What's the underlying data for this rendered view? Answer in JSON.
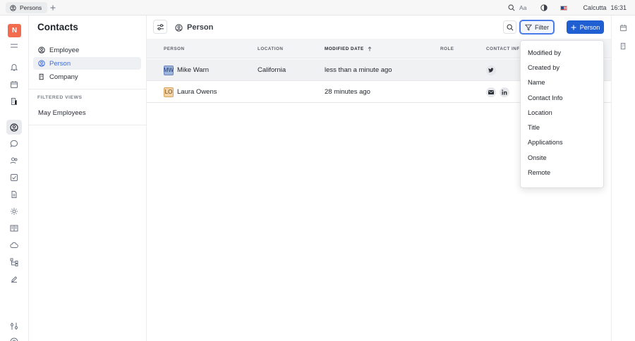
{
  "tabs": [
    {
      "label": "Persons",
      "icon": "person-circle-icon"
    }
  ],
  "topbar": {
    "font_label": "Aa",
    "location": "Calcutta",
    "time": "16:31"
  },
  "workspace": {
    "logo_letter": "N",
    "logo_color": "#f26c4f"
  },
  "contacts_panel": {
    "title": "Contacts",
    "items": [
      {
        "label": "Employee",
        "icon": "person-circle-icon",
        "active": false
      },
      {
        "label": "Person",
        "icon": "person-circle-icon",
        "active": true
      },
      {
        "label": "Company",
        "icon": "building-icon",
        "active": false
      }
    ],
    "filtered_views_label": "FILTERED VIEWS",
    "views": [
      {
        "label": "May Employees"
      }
    ]
  },
  "main": {
    "title": "Person",
    "filter_label": "Filter",
    "add_label": "Person",
    "accent_color": "#1f5fd1"
  },
  "table": {
    "columns": [
      "PERSON",
      "LOCATION",
      "MODIFIED DATE",
      "ROLE",
      "CONTACT INFO"
    ],
    "rows": [
      {
        "initials": "MW",
        "name": "Mike Warn",
        "location": "California",
        "modified": "less than a minute ago",
        "role": "",
        "contacts": [
          "twitter-icon"
        ]
      },
      {
        "initials": "LO",
        "name": "Laura Owens",
        "location": "",
        "modified": "28 minutes ago",
        "role": "",
        "contacts": [
          "mail-icon",
          "linkedin-icon"
        ]
      }
    ]
  },
  "filter_menu": {
    "items": [
      "Modified by",
      "Created by",
      "Name",
      "Contact Info",
      "Location",
      "Title",
      "Applications",
      "Onsite",
      "Remote"
    ]
  }
}
